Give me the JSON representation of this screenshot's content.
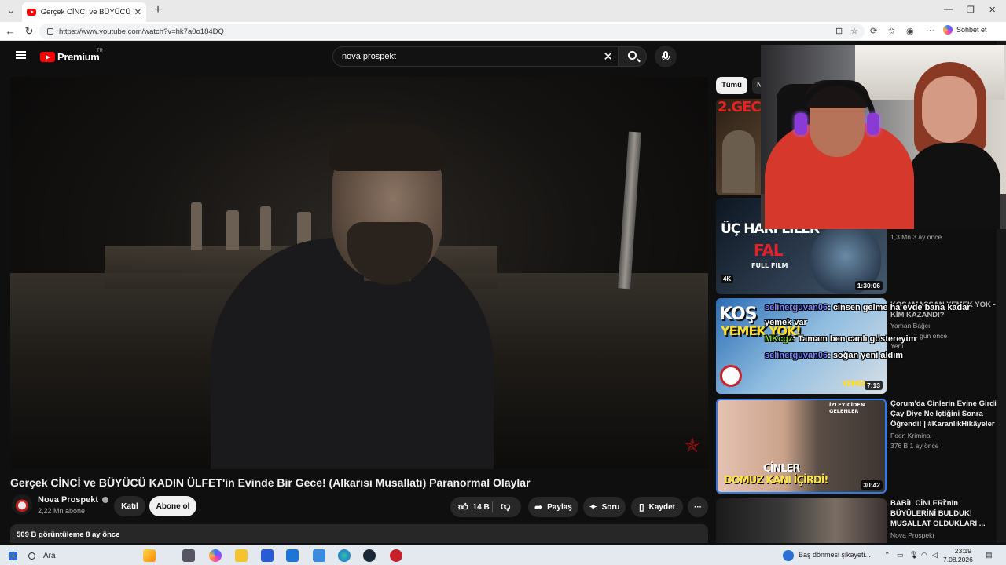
{
  "browser": {
    "tab_title": "Gerçek CİNCİ ve BÜYÜCÜ KADIN Ü",
    "url": "https://www.youtube.com/watch?v=hk7a0o184DQ",
    "chat_button": "Sohbet et"
  },
  "yt": {
    "logo_text": "Premium",
    "logo_sup": "TR",
    "search_value": "nova prospekt",
    "chips": [
      "Tümü",
      "N"
    ]
  },
  "video": {
    "title": "Gerçek CİNCİ ve BÜYÜCÜ KADIN ÜLFET'in Evinde Bir Gece! (Alkarısı Musallatı) Paranormal Olaylar",
    "channel": "Nova Prospekt",
    "subscribers": "2,22 Mn abone",
    "join": "Katıl",
    "subscribe": "Abone ol",
    "likes": "14 B",
    "share": "Paylaş",
    "ask": "Soru",
    "save": "Kaydet",
    "more": "···",
    "stats": "509 B görüntüleme  8 ay önce"
  },
  "sidebar": [
    {
      "title": "",
      "meta1": "",
      "meta2": "",
      "duration": "",
      "thumb_text": "2.GECE"
    },
    {
      "title": "",
      "meta1": "",
      "meta2": "1,3 Mn  3 ay önce",
      "duration": "1:30:06",
      "thumb_text": "ÜÇ HARFLİLER",
      "thumb_text2": "FAL",
      "thumb_text3": "FULL FILM",
      "badge": "4K"
    },
    {
      "title": "KOSAMASSAN YEMEK YOK - KİM KAZANDI?",
      "meta1": "Yaman Bağcı",
      "meta2": "1 gün önce",
      "duration": "7:13",
      "thumb_text": "KOŞ",
      "thumb_text2": "YEMEK YOK!",
      "thumb_text3": "YEMEK",
      "extra": "Yeni"
    },
    {
      "title": "Çorum'da Cinlerin Evine Girdi, Çay Diye Ne İçtiğini Sonra Öğrendi! | #KaranlıkHikâyeler",
      "meta1": "Foon Kriminal",
      "meta2": "376 B  1 ay önce",
      "duration": "30:42",
      "thumb_text": "CİNLER",
      "thumb_text2": "DOMUZ KANI İÇİRDİ!",
      "thumb_text3": "İZLEYİCİDEN GELENLER"
    },
    {
      "title": "BABİL CİNLERİ'nin BÜYÜLERİNİ BULDUK! MUSALLAT OLDUKLARI ...",
      "meta1": "Nova Prospekt",
      "meta2": "",
      "duration": ""
    }
  ],
  "chat": [
    {
      "user": "selinerguvan06",
      "msg": ": cinsen gelme ha evde bana kadar"
    },
    {
      "user": "",
      "msg": "yemek var"
    },
    {
      "user": "MKcgz",
      "msg": ": Tamam ben canlı göstereyim"
    },
    {
      "user": "selinerguvan06",
      "msg": ": soğan yeni aldım"
    }
  ],
  "taskbar": {
    "search": "Ara",
    "notification": "Baş dönmesi şikayeti...",
    "time": "23:19",
    "date": "7.08.2026"
  },
  "colors": {
    "youtube_red": "#ff0000",
    "bg": "#0f0f0f",
    "chat_user1": "#7b86ff",
    "chat_user2": "#8dd34a"
  }
}
